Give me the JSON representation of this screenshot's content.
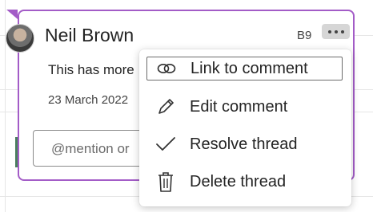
{
  "comment": {
    "author": "Neil Brown",
    "cell_reference": "B9",
    "text": "This has more",
    "date": "23 March 2022",
    "reply_placeholder": "@mention or"
  },
  "icons": {
    "more": "more-options-icon",
    "link": "link-icon",
    "edit": "pencil-icon",
    "resolve": "checkmark-icon",
    "delete": "trash-icon"
  },
  "menu": {
    "items": [
      {
        "label": "Link to comment",
        "icon": "link-icon"
      },
      {
        "label": "Edit comment",
        "icon": "pencil-icon"
      },
      {
        "label": "Resolve thread",
        "icon": "checkmark-icon"
      },
      {
        "label": "Delete thread",
        "icon": "trash-icon"
      }
    ]
  },
  "colors": {
    "card_border": "#a35cc7",
    "accent_green": "#4a7f5e"
  }
}
